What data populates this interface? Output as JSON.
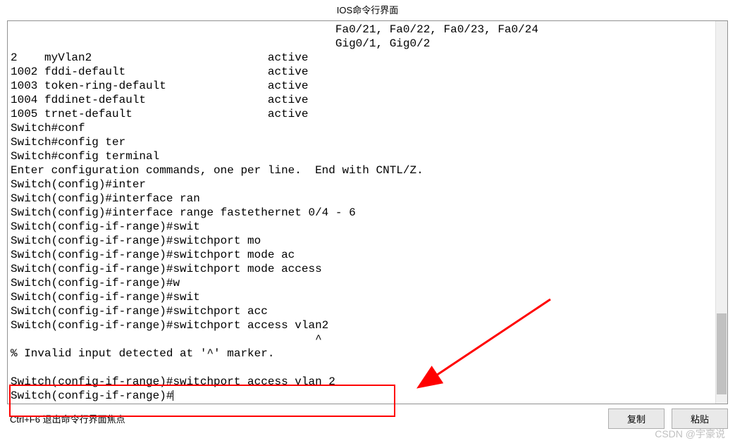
{
  "title": "IOS命令行界面",
  "terminal_lines": [
    "                                                Fa0/21, Fa0/22, Fa0/23, Fa0/24",
    "                                                Gig0/1, Gig0/2",
    "2    myVlan2                          active    ",
    "1002 fddi-default                     active    ",
    "1003 token-ring-default               active    ",
    "1004 fddinet-default                  active    ",
    "1005 trnet-default                    active    ",
    "Switch#conf",
    "Switch#config ter",
    "Switch#config terminal",
    "Enter configuration commands, one per line.  End with CNTL/Z.",
    "Switch(config)#inter",
    "Switch(config)#interface ran",
    "Switch(config)#interface range fastethernet 0/4 - 6",
    "Switch(config-if-range)#swit",
    "Switch(config-if-range)#switchport mo",
    "Switch(config-if-range)#switchport mode ac",
    "Switch(config-if-range)#switchport mode access",
    "Switch(config-if-range)#w",
    "Switch(config-if-range)#swit",
    "Switch(config-if-range)#switchport acc",
    "Switch(config-if-range)#switchport access vlan2",
    "                                             ^",
    "% Invalid input detected at '^' marker.",
    "\t",
    "Switch(config-if-range)#switchport access vlan 2",
    "Switch(config-if-range)#"
  ],
  "footer": {
    "hint": "Ctrl+F6 退出命令行界面焦点",
    "copy": "复制",
    "paste": "粘贴"
  },
  "watermark": "CSDN @宇豪说"
}
